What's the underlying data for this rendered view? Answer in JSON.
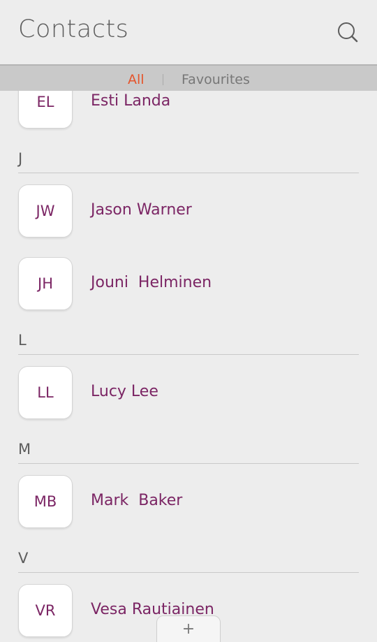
{
  "header": {
    "title": "Contacts",
    "search_icon": "search-icon"
  },
  "tabs": {
    "all": "All",
    "favourites": "Favourites",
    "active_color": "#e5542b"
  },
  "sections": {
    "j": "J",
    "l": "L",
    "m": "M",
    "v": "V"
  },
  "contacts": {
    "el": {
      "initials": "EL",
      "name": "Esti Landa"
    },
    "jw": {
      "initials": "JW",
      "name": "Jason Warner"
    },
    "jh": {
      "initials": "JH",
      "name": "Jouni  Helminen"
    },
    "ll": {
      "initials": "LL",
      "name": "Lucy Lee"
    },
    "mb": {
      "initials": "MB",
      "name": "Mark  Baker"
    },
    "vr": {
      "initials": "VR",
      "name": "Vesa Rautiainen"
    }
  },
  "add_button": {
    "label": "+"
  },
  "colors": {
    "name_text": "#7b2564",
    "background": "#ededed"
  }
}
